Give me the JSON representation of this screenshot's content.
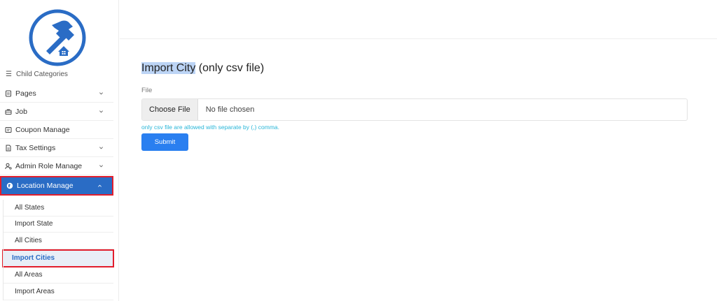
{
  "sidebar": {
    "cut_item": {
      "label": "Child Categories",
      "icon": "list-icon"
    },
    "items": [
      {
        "label": "Pages",
        "icon": "pages-icon",
        "has_chevron": true
      },
      {
        "label": "Job",
        "icon": "briefcase-icon",
        "has_chevron": true
      },
      {
        "label": "Coupon Manage",
        "icon": "coupon-icon",
        "has_chevron": false
      },
      {
        "label": "Tax Settings",
        "icon": "tax-icon",
        "has_chevron": true
      },
      {
        "label": "Admin Role Manage",
        "icon": "user-role-icon",
        "has_chevron": true
      },
      {
        "label": "Location Manage",
        "icon": "globe-icon",
        "has_chevron": true,
        "active": true
      }
    ],
    "submenu": [
      {
        "label": "All States"
      },
      {
        "label": "Import State"
      },
      {
        "label": "All Cities"
      },
      {
        "label": "Import Cities",
        "selected": true
      },
      {
        "label": "All Areas"
      },
      {
        "label": "Import Areas"
      }
    ]
  },
  "main": {
    "title_highlight": "Import City",
    "title_rest": " (only csv file)",
    "field_label": "File",
    "choose_file": "Choose File",
    "file_status": "No file chosen",
    "help_text": "only csv file are allowed with separate by (,) comma.",
    "submit_label": "Submit"
  },
  "colors": {
    "accent": "#2a6cc5",
    "submit": "#2a7ff0",
    "highlight_border": "#e21d2c",
    "help_text": "#29b6d8",
    "logo": "#2a6cc5"
  }
}
